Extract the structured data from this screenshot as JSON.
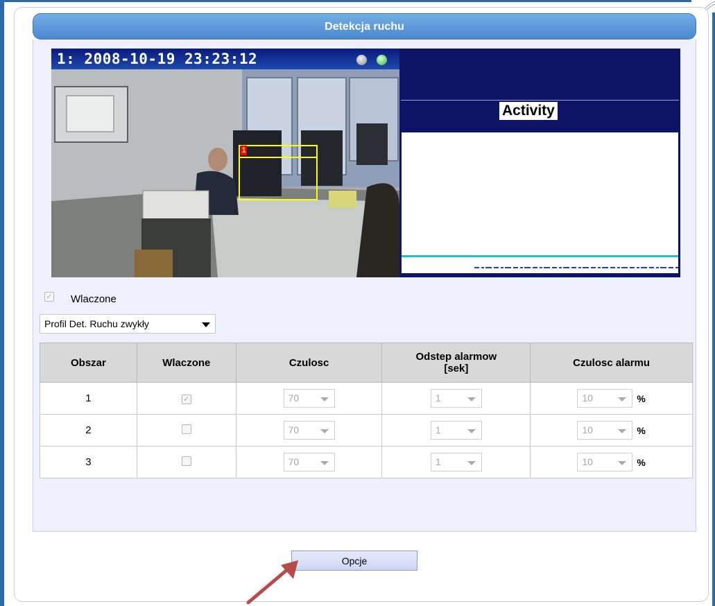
{
  "panel": {
    "title": "Detekcja ruchu"
  },
  "camera": {
    "osd_text": "1:  2008-10-19 23:23:12",
    "zone_marker": "1"
  },
  "activity": {
    "title": "Activity"
  },
  "motion_detection": {
    "enabled_label": "Wlaczone",
    "enabled_checked": true
  },
  "profile": {
    "selected": "Profil Det. Ruchu zwykły"
  },
  "table": {
    "headers": {
      "zone": "Obszar",
      "enabled": "Wlaczone",
      "sensitivity": "Czulosc",
      "interval_line1": "Odstep alarmow",
      "interval_line2": "[sek]",
      "alarm_sensitivity": "Czulosc alarmu"
    },
    "percent_unit": "%",
    "rows": [
      {
        "zone": "1",
        "enabled": true,
        "sensitivity": "70",
        "interval": "1",
        "alarm_sensitivity": "10"
      },
      {
        "zone": "2",
        "enabled": false,
        "sensitivity": "70",
        "interval": "1",
        "alarm_sensitivity": "10"
      },
      {
        "zone": "3",
        "enabled": false,
        "sensitivity": "70",
        "interval": "1",
        "alarm_sensitivity": "10"
      }
    ]
  },
  "options_button": {
    "label": "Opcje"
  },
  "colors": {
    "accent": "#4a88cf",
    "arrow": "#b84a4a",
    "activity_bg": "#0d1466"
  },
  "icons": {
    "osd_lamp_1": "gray-status-dot",
    "osd_lamp_2": "green-status-dot",
    "annotation": "red-arrow"
  }
}
